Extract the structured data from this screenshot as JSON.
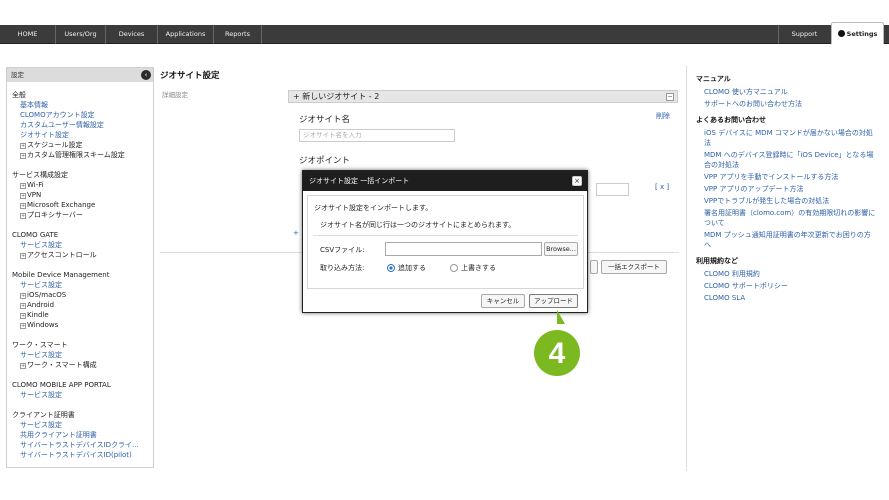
{
  "nav": {
    "items": [
      "HOME",
      "Users/Org",
      "Devices",
      "Applications",
      "Reports"
    ],
    "support": "Support",
    "settings": "Settings"
  },
  "sidebar": {
    "header": "設定",
    "sections": [
      {
        "title": "全般",
        "items": [
          {
            "label": "基本情報",
            "expand": false
          },
          {
            "label": "CLOMOアカウント設定",
            "expand": false
          },
          {
            "label": "カスタムユーザー情報設定",
            "expand": false
          },
          {
            "label": "ジオサイト設定",
            "expand": false
          },
          {
            "label": "スケジュール設定",
            "expand": true
          },
          {
            "label": "カスタム管理権限スキーム設定",
            "expand": true
          }
        ]
      },
      {
        "title": "サービス構成設定",
        "items": [
          {
            "label": "Wi-Fi",
            "expand": true
          },
          {
            "label": "VPN",
            "expand": true
          },
          {
            "label": "Microsoft Exchange",
            "expand": true
          },
          {
            "label": "プロキシサーバー",
            "expand": true
          }
        ]
      },
      {
        "title": "CLOMO GATE",
        "items": [
          {
            "label": "サービス設定",
            "expand": false
          },
          {
            "label": "アクセスコントロール",
            "expand": true
          }
        ]
      },
      {
        "title": "Mobile Device Management",
        "items": [
          {
            "label": "サービス設定",
            "expand": false
          },
          {
            "label": "iOS/macOS",
            "expand": true
          },
          {
            "label": "Android",
            "expand": true
          },
          {
            "label": "Kindle",
            "expand": true
          },
          {
            "label": "Windows",
            "expand": true
          }
        ]
      },
      {
        "title": "ワーク・スマート",
        "items": [
          {
            "label": "サービス設定",
            "expand": false
          },
          {
            "label": "ワーク・スマート構成",
            "expand": true
          }
        ]
      },
      {
        "title": "CLOMO MOBILE APP PORTAL",
        "items": [
          {
            "label": "サービス設定",
            "expand": false
          }
        ]
      },
      {
        "title": "クライアント証明書",
        "items": [
          {
            "label": "サービス設定",
            "expand": false
          },
          {
            "label": "共用クライアント証明書",
            "expand": false
          },
          {
            "label": "サイバートラストデバイスIDクライ...",
            "expand": false
          },
          {
            "label": "サイバートラストデバイスID(pilot)",
            "expand": false
          }
        ]
      }
    ]
  },
  "main": {
    "title": "ジオサイト設定",
    "sublabel": "詳細設定",
    "panel_title": "+ 新しいジオサイト - 2",
    "geosite_name_label": "ジオサイト名",
    "geosite_name_placeholder": "ジオサイト名を入力",
    "delete": "削除",
    "geopoint_label": "ジオポイント",
    "remove_point": "[ x ]",
    "add_symbol": "+",
    "export_button": "一括エクスポート"
  },
  "right": {
    "manual_title": "マニュアル",
    "manual_links": [
      "CLOMO 使い方マニュアル",
      "サポートへのお問い合わせ方法"
    ],
    "faq_title": "よくあるお問い合わせ",
    "faq_links": [
      "iOS デバイスに MDM コマンドが届かない場合の対処法",
      "MDM へのデバイス登録時に「iOS Device」となる場合の対処法",
      "VPP アプリを手動でインストールする方法",
      "VPP アプリのアップデート方法",
      "VPPでトラブルが発生した場合の対処法",
      "署名用証明書（clomo.com）の有効期限切れの影響について",
      "MDM プッシュ通知用証明書の年次更新でお困りの方へ"
    ],
    "terms_title": "利用規約など",
    "terms_links": [
      "CLOMO 利用規約",
      "CLOMO サポートポリシー",
      "CLOMO SLA"
    ]
  },
  "modal": {
    "title": "ジオサイト設定 一括インポート",
    "close": "×",
    "line1": "ジオサイト設定をインポートします。",
    "line2": "ジオサイト名が同じ行は一つのジオサイトにまとめられます。",
    "csv_label": "CSVファイル:",
    "browse": "Browse...",
    "mode_label": "取り込み方法:",
    "mode_add": "追加する",
    "mode_overwrite": "上書きする",
    "mode_selected": "追加する",
    "cancel": "キャンセル",
    "upload": "アップロード"
  },
  "callout": {
    "number": "4",
    "color": "#7cb81f"
  }
}
